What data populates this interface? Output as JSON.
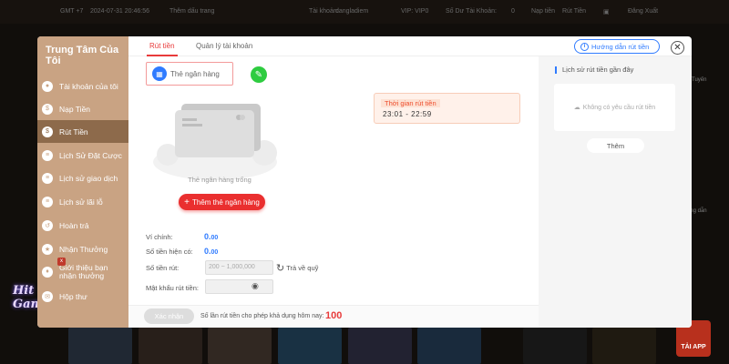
{
  "topbar": {
    "timezone": "GMT +7",
    "datetime": "2024-07-31 20:46:56",
    "bookmark": "Thêm dấu trang",
    "account_label": "Tài khoản:",
    "account_value": "dangladiem",
    "vip": "VIP: VIP0",
    "balance_label": "Số Dư Tài Khoản:",
    "balance_value": "0",
    "deposit": "Nạp tiền",
    "withdraw": "Rút Tiền",
    "logout": "Đăng Xuất"
  },
  "bg_right": [
    "Trực Tuyến",
    "",
    "",
    "",
    "Hướng dẫn"
  ],
  "tai_app": "TẢI APP",
  "logo_text": "Hit Game",
  "sidebar": {
    "title": "Trung Tâm Của Tôi",
    "items": [
      {
        "label": "Tài khoản của tôi",
        "icon": "user-icon"
      },
      {
        "label": "Nạp Tiền",
        "icon": "deposit-icon"
      },
      {
        "label": "Rút Tiền",
        "icon": "withdraw-icon"
      },
      {
        "label": "Lịch Sử Đặt Cược",
        "icon": "bet-history-icon"
      },
      {
        "label": "Lịch sử giao dịch",
        "icon": "transaction-icon"
      },
      {
        "label": "Lịch sử lãi lỗ",
        "icon": "profit-loss-icon"
      },
      {
        "label": "Hoàn trả",
        "icon": "rebate-icon"
      },
      {
        "label": "Nhận Thưởng",
        "icon": "reward-icon"
      },
      {
        "label": "Giới thiệu bạn nhận thưởng",
        "icon": "referral-icon"
      },
      {
        "label": "Hộp thư",
        "icon": "mailbox-icon"
      }
    ],
    "badge": "x"
  },
  "tabs": [
    {
      "label": "Rút tiền"
    },
    {
      "label": "Quản lý tài khoản"
    }
  ],
  "guide_label": "Hướng dẫn rút tiền",
  "bank_card_label": "Thẻ ngân hàng",
  "empty_card_text": "Thẻ ngân hàng trống",
  "add_card_label": "Thêm thẻ ngân hàng",
  "withdraw_time": {
    "label": "Thời gian rút tiền",
    "value": "23:01  - 22:59"
  },
  "form": {
    "wallet_label": "Ví chính:",
    "wallet_value": "0.",
    "wallet_decimal": "00",
    "available_label": "Số tiền hiện có:",
    "available_value": "0.",
    "available_decimal": "00",
    "amount_label": "Số tiền rút:",
    "amount_placeholder": "200 ~ 1,000,000",
    "refund_label": "Trả về quỹ",
    "password_label": "Mật khẩu rút tiền:"
  },
  "footer": {
    "confirm_label": "Xác nhận",
    "remaining_text": "Số lần rút tiền cho phép khả dụng hôm nay:",
    "remaining_count": "100"
  },
  "history": {
    "title": "Lịch sử rút tiền gần đây",
    "empty": "Không có yêu cầu rút tiền",
    "more_label": "Thêm"
  }
}
